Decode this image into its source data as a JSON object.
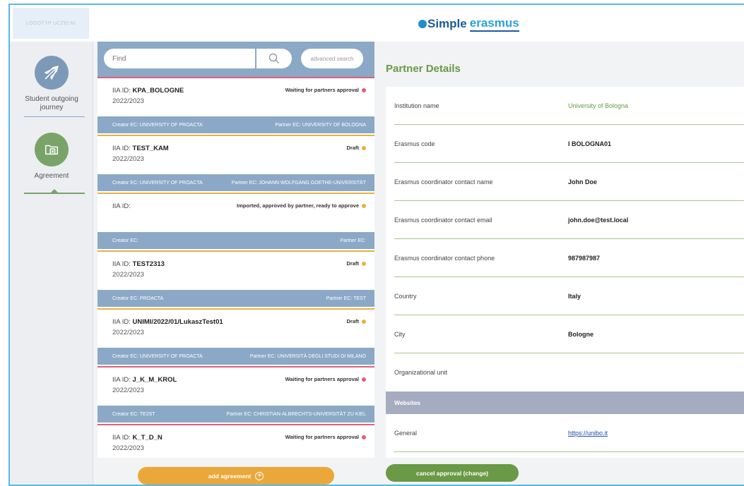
{
  "header": {
    "logo_text": "LOGOTYP UCZELNI",
    "brand_simple": "Simple",
    "brand_erasmus": "erasmus"
  },
  "sidebar": {
    "items": [
      {
        "label": "Student outgoing journey",
        "icon": "plane-icon",
        "color": "#7c9ab8"
      },
      {
        "label": "Agreement",
        "icon": "folder-document-icon",
        "color": "#7aa36a"
      }
    ]
  },
  "search": {
    "placeholder": "Find",
    "advanced_label": "advanced search"
  },
  "cards": [
    {
      "iia_prefix": "IIA ID:",
      "iia_id": "KPA_BOLOGNE",
      "year": "2022/2023",
      "status": "Waiting for partners approval",
      "status_color": "pink",
      "creator": "Creator EC: UNIVERSITY OF PROACTA",
      "partner": "Partner EC: UNIVERSITY OF BOLOGNA"
    },
    {
      "iia_prefix": "IIA ID:",
      "iia_id": "TEST_KAM",
      "year": "2022/2023",
      "status": "Draft",
      "status_color": "orange",
      "creator": "Creator EC: UNIVERSITY OF PROACTA",
      "partner": "Partner EC: JOHANN WOLFGANG GOETHE-UNIVERSITÄT"
    },
    {
      "iia_prefix": "IIA ID:",
      "iia_id": "",
      "year": "",
      "status": "Imported, approved by partner, ready to approve",
      "status_color": "orange",
      "creator": "Creator EC:",
      "partner": "Partner EC:"
    },
    {
      "iia_prefix": "IIA ID:",
      "iia_id": "TEST2313",
      "year": "2022/2023",
      "status": "Draft",
      "status_color": "orange",
      "creator": "Creator EC: PROACTA",
      "partner": "Partner EC: TEST"
    },
    {
      "iia_prefix": "IIA ID:",
      "iia_id": "UNIMI/2022/01/LukaszTest01",
      "year": "2022/2023",
      "status": "Draft",
      "status_color": "orange",
      "creator": "Creator EC: UNIVERSITY OF PROACTA",
      "partner": "Partner EC: UNIVERSITÀ DEGLI STUDI DI MILANO"
    },
    {
      "iia_prefix": "IIA ID:",
      "iia_id": "J_K_M_KROL",
      "year": "2022/2023",
      "status": "Waiting for partners approval",
      "status_color": "pink",
      "creator": "Creator EC: TE2ST",
      "partner": "Partner EC: CHRISTIAN-ALBRECHTS-UNIVERSITÄT ZU KIEL"
    },
    {
      "iia_prefix": "IIA ID:",
      "iia_id": "K_T_D_N",
      "year": "2022/2023",
      "status": "Waiting for partners approval",
      "status_color": "pink",
      "creator": "",
      "partner": ""
    }
  ],
  "add_agreement_label": "add agreement",
  "details": {
    "title": "Partner Details",
    "rows": [
      {
        "label": "Institution name",
        "value": "University of Bologna"
      },
      {
        "label": "Erasmus code",
        "value": "I BOLOGNA01"
      },
      {
        "label": "Erasmus coordinator contact name",
        "value": "John Doe"
      },
      {
        "label": "Erasmus coordinator contact email",
        "value": "john.doe@test.local"
      },
      {
        "label": "Erasmus coordinator contact phone",
        "value": "987987987"
      },
      {
        "label": "Country",
        "value": "Italy"
      },
      {
        "label": "City",
        "value": "Bologne"
      },
      {
        "label": "Organizational unit",
        "value": ""
      }
    ],
    "websites_heading": "Websites",
    "website_row": {
      "label": "General",
      "value": "https://unibo.it"
    }
  },
  "cancel_approval_label": "cancel approval (change)",
  "colors": {
    "accent_green": "#6a9a45",
    "accent_orange": "#eba83a",
    "list_blue": "#8ba9c6",
    "status_pink": "#e25d78"
  }
}
